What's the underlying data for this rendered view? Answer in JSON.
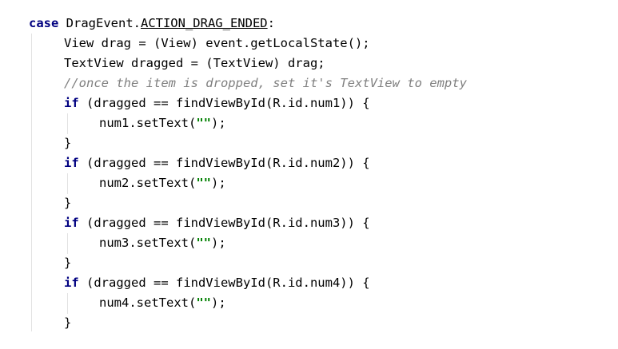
{
  "code_editor": {
    "line1": {
      "keyword": "case",
      "text": " DragEvent.",
      "constant": "ACTION_DRAG_ENDED",
      "suffix": ":"
    },
    "line2": "View drag = (View) event.getLocalState();",
    "line3": "TextView dragged = (TextView) drag;",
    "line4_comment": "//once the item is dropped, set it's TextView to empty",
    "if_blocks": [
      {
        "keyword": "if",
        "condition": " (dragged == findViewById(R.id.num1)) {",
        "body_call": "num1.setText(",
        "body_string": "\"\"",
        "body_end": ");",
        "closing": "}"
      },
      {
        "keyword": "if",
        "condition": " (dragged == findViewById(R.id.num2)) {",
        "body_call": "num2.setText(",
        "body_string": "\"\"",
        "body_end": ");",
        "closing": "}"
      },
      {
        "keyword": "if",
        "condition": " (dragged == findViewById(R.id.num3)) {",
        "body_call": "num3.setText(",
        "body_string": "\"\"",
        "body_end": ");",
        "closing": "}"
      },
      {
        "keyword": "if",
        "condition": " (dragged == findViewById(R.id.num4)) {",
        "body_call": "num4.setText(",
        "body_string": "\"\"",
        "body_end": ");",
        "closing": "}"
      }
    ],
    "colors": {
      "background": "#ffffff",
      "keyword": "#000080",
      "comment": "#808080",
      "string": "#008000",
      "plain": "#000000",
      "indent_guide": "#e2e2e2"
    }
  }
}
